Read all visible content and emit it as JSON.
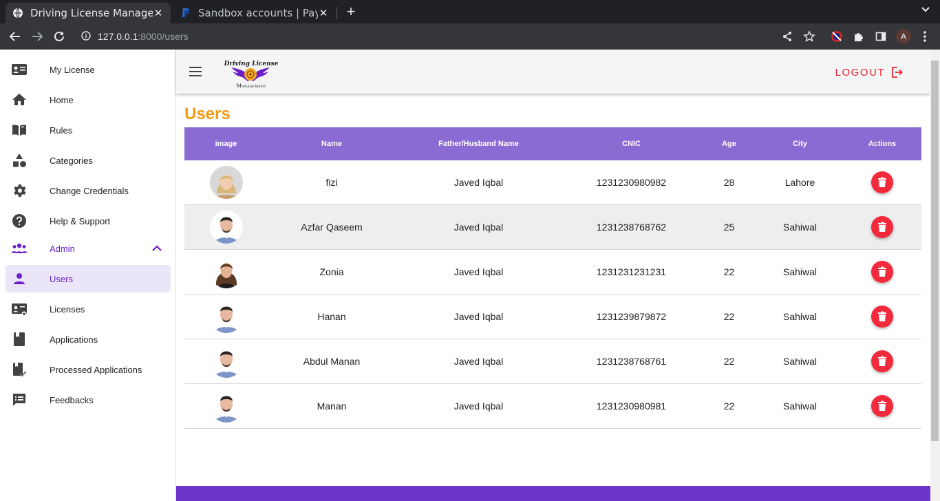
{
  "browser": {
    "tabs": [
      {
        "title": "Driving License Managem",
        "active": true
      },
      {
        "title": "Sandbox accounts | PayPa",
        "active": false
      }
    ],
    "url_host": "127.0.0.1",
    "url_path": ":8000/users",
    "profile_initial": "A"
  },
  "sidebar": {
    "items": [
      {
        "label": "My License",
        "icon": "id-card-icon"
      },
      {
        "label": "Home",
        "icon": "home-icon"
      },
      {
        "label": "Rules",
        "icon": "book-icon"
      },
      {
        "label": "Categories",
        "icon": "shapes-icon"
      },
      {
        "label": "Change Credentials",
        "icon": "gear-icon"
      },
      {
        "label": "Help & Support",
        "icon": "help-icon"
      },
      {
        "label": "Admin",
        "icon": "group-icon"
      },
      {
        "label": "Users",
        "icon": "person-icon"
      },
      {
        "label": "Licenses",
        "icon": "license-icon"
      },
      {
        "label": "Applications",
        "icon": "applications-icon"
      },
      {
        "label": "Processed Applications",
        "icon": "processed-icon"
      },
      {
        "label": "Feedbacks",
        "icon": "feedback-icon"
      }
    ]
  },
  "header": {
    "logo_line1": "Driving License",
    "logo_line2": "Management",
    "logout_label": "LOGOUT"
  },
  "page": {
    "title": "Users"
  },
  "table": {
    "columns": [
      "image",
      "Name",
      "Father/Husband Name",
      "CNIC",
      "Age",
      "City",
      "Actions"
    ],
    "rows": [
      {
        "name": "fizi",
        "father": "Javed Iqbal",
        "cnic": "1231230980982",
        "age": "28",
        "city": "Lahore",
        "avatar": "female-blonde"
      },
      {
        "name": "Azfar Qaseem",
        "father": "Javed Iqbal",
        "cnic": "1231238768762",
        "age": "25",
        "city": "Sahiwal",
        "avatar": "male"
      },
      {
        "name": "Zonia",
        "father": "Javed Iqbal",
        "cnic": "1231231231231",
        "age": "22",
        "city": "Sahiwal",
        "avatar": "female-brunette"
      },
      {
        "name": "Hanan",
        "father": "Javed Iqbal",
        "cnic": "1231239879872",
        "age": "22",
        "city": "Sahiwal",
        "avatar": "male"
      },
      {
        "name": "Abdul Manan",
        "father": "Javed Iqbal",
        "cnic": "1231238768761",
        "age": "22",
        "city": "Sahiwal",
        "avatar": "male"
      },
      {
        "name": "Manan",
        "father": "Javed Iqbal",
        "cnic": "1231230980981",
        "age": "22",
        "city": "Sahiwal",
        "avatar": "male"
      }
    ]
  },
  "colors": {
    "accent": "#6a1fc9",
    "table_header": "#8a6ad3",
    "title": "#f39a12",
    "logout": "#e8212e",
    "delete": "#f22a3c",
    "footer": "#6d34c9"
  }
}
